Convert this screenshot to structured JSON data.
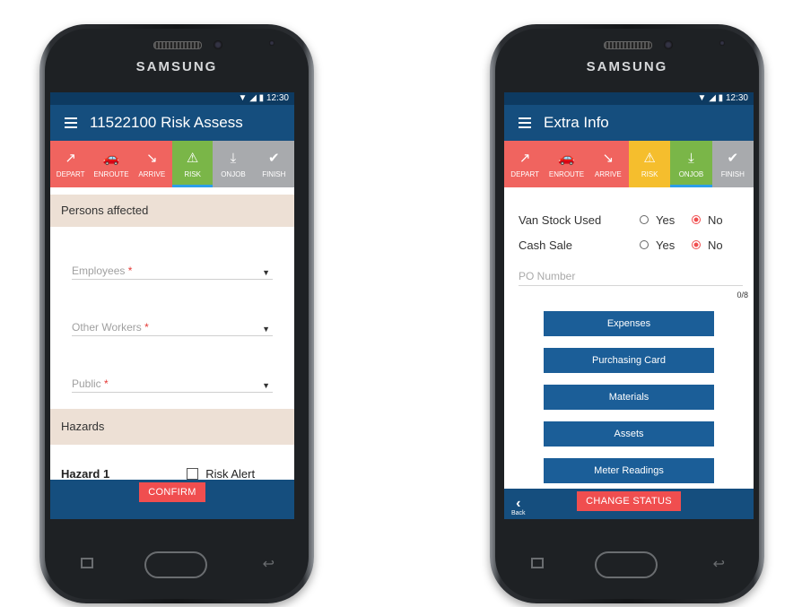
{
  "device": {
    "brand": "SAMSUNG"
  },
  "left": {
    "status_time": "12:30",
    "title": "11522100 Risk Assess",
    "steps": [
      {
        "label": "DEPART",
        "icon": "↗"
      },
      {
        "label": "ENROUTE",
        "icon": "🚗"
      },
      {
        "label": "ARRIVE",
        "icon": "↘"
      },
      {
        "label": "RISK",
        "icon": "⚠"
      },
      {
        "label": "ONJOB",
        "icon": "⤓"
      },
      {
        "label": "FINISH",
        "icon": "✔"
      }
    ],
    "section_persons": "Persons affected",
    "fields": {
      "employees": "Employees",
      "other_workers": "Other Workers",
      "public": "Public",
      "required_mark": "*"
    },
    "section_hazards": "Hazards",
    "hazard_label": "Hazard 1",
    "risk_alert": "Risk Alert",
    "confirm": "CONFIRM"
  },
  "right": {
    "status_time": "12:30",
    "title": "Extra Info",
    "steps": [
      {
        "label": "DEPART",
        "icon": "↗"
      },
      {
        "label": "ENROUTE",
        "icon": "🚗"
      },
      {
        "label": "ARRIVE",
        "icon": "↘"
      },
      {
        "label": "RISK",
        "icon": "⚠"
      },
      {
        "label": "ONJOB",
        "icon": "⤓"
      },
      {
        "label": "FINISH",
        "icon": "✔"
      }
    ],
    "van_stock": {
      "label": "Van Stock Used",
      "yes": "Yes",
      "no": "No",
      "selected": "No"
    },
    "cash_sale": {
      "label": "Cash Sale",
      "yes": "Yes",
      "no": "No",
      "selected": "No"
    },
    "po_placeholder": "PO Number",
    "po_counter": "0/8",
    "buttons": [
      "Expenses",
      "Purchasing Card",
      "Materials",
      "Assets",
      "Meter Readings"
    ],
    "back_label": "Back",
    "change_status": "CHANGE STATUS"
  }
}
